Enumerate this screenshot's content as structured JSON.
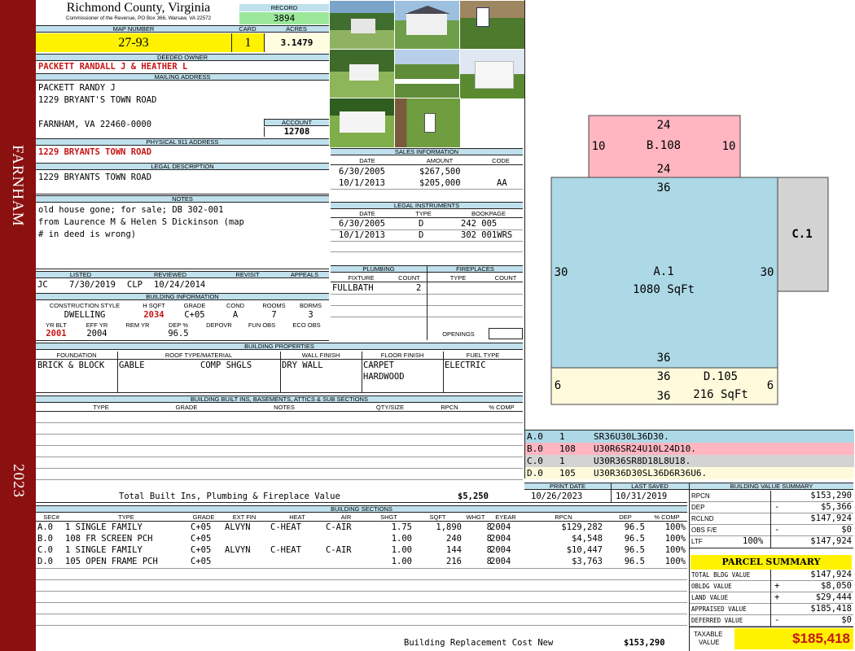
{
  "sidebar": {
    "city": "FARNHAM",
    "year": "2023"
  },
  "header": {
    "county": "Richmond County, Virginia",
    "commissioner": "Commissioner of the Revenue, PO Box 366, Warsaw, VA 22572",
    "record_label": "RECORD",
    "record": "3894",
    "map_number_label": "MAP NUMBER",
    "map_number": "27-93",
    "card_label": "CARD",
    "card": "1",
    "acres_label": "ACRES",
    "acres": "3.1479"
  },
  "owner": {
    "deeded_owner_label": "DEEDED OWNER",
    "deeded_owner": "PACKETT RANDALL J & HEATHER L",
    "mailing_label": "MAILING ADDRESS",
    "mailing_line1": "PACKETT RANDY J",
    "mailing_line2": "1229 BRYANT'S TOWN ROAD",
    "mailing_line3": "FARNHAM, VA 22460-0000",
    "account_label": "ACCOUNT",
    "account": "12708",
    "physical_label": "PHYSICAL 911 ADDRESS",
    "physical": "1229 BRYANTS TOWN ROAD",
    "legal_label": "LEGAL DESCRIPTION",
    "legal": "1229 BRYANTS TOWN ROAD",
    "notes_label": "NOTES",
    "notes_line1": "old house gone; for sale; DB 302-001",
    "notes_line2": "from Laurence M & Helen S Dickinson (map",
    "notes_line3": "# in deed is wrong)"
  },
  "review": {
    "listed_label": "LISTED",
    "reviewed_label": "REVIEWED",
    "revisit_label": "REVISIT",
    "appeals_label": "APPEALS",
    "listed_by": "JC",
    "listed_date": "7/30/2019",
    "reviewed_by": "CLP",
    "reviewed_date": "10/24/2014"
  },
  "building_info": {
    "title": "BUILDING INFORMATION",
    "headers": [
      "CONSTRUCTION STYLE",
      "H SQFT",
      "GRADE",
      "COND",
      "ROOMS",
      "BDRMS"
    ],
    "style": "DWELLING",
    "hsqft": "2034",
    "grade": "C+05",
    "cond": "A",
    "rooms": "7",
    "bdrms": "3",
    "headers2": [
      "YR BLT",
      "EFF YR",
      "REM YR",
      "DEP %",
      "DEPOVR",
      "FUN OBS",
      "ECO OBS"
    ],
    "yr_blt": "2001",
    "eff_yr": "2004",
    "dep": "96.5"
  },
  "sales": {
    "title": "SALES INFORMATION",
    "headers": [
      "DATE",
      "AMOUNT",
      "CODE"
    ],
    "rows": [
      {
        "date": "6/30/2005",
        "amount": "$267,500",
        "code": ""
      },
      {
        "date": "10/1/2013",
        "amount": "$205,000",
        "code": "AA"
      }
    ]
  },
  "legal_instruments": {
    "title": "LEGAL INSTRUMENTS",
    "headers": [
      "DATE",
      "TYPE",
      "BOOKPAGE"
    ],
    "rows": [
      {
        "date": "6/30/2005",
        "type": "D",
        "bookpage": "242 005"
      },
      {
        "date": "10/1/2013",
        "type": "D",
        "bookpage": "302 001WRS"
      }
    ]
  },
  "plumbing": {
    "title": "PLUMBING",
    "fixture_label": "FIXTURE",
    "count_label": "COUNT",
    "fixture": "FULLBATH",
    "count": "2"
  },
  "fireplaces": {
    "title": "FIREPLACES",
    "type_label": "TYPE",
    "count_label": "COUNT",
    "openings_label": "OPENINGS"
  },
  "building_properties": {
    "title": "BUILDING PROPERTIES",
    "headers": [
      "FOUNDATION",
      "ROOF TYPE/MATERIAL",
      "WALL FINISH",
      "FLOOR FINISH",
      "FUEL TYPE"
    ],
    "foundation": "BRICK & BLOCK",
    "roof_type": "GABLE",
    "roof_material": "COMP SHGLS",
    "wall": "DRY WALL",
    "floor1": "CARPET",
    "floor2": "HARDWOOD",
    "fuel": "ELECTRIC"
  },
  "built_ins": {
    "title": "BUILDING BUILT INS, BASEMENTS, ATTICS & SUB SECTIONS",
    "headers": [
      "TYPE",
      "GRADE",
      "NOTES",
      "QTY/SIZE",
      "RPCN",
      "% COMP"
    ],
    "total_label": "Total Built Ins, Plumbing & Fireplace Value",
    "total": "$5,250"
  },
  "sections": {
    "title": "BUILDING SECTIONS",
    "headers": [
      "SEC#",
      "TYPE",
      "GRADE",
      "EXT FIN",
      "HEAT",
      "AIR",
      "SHGT",
      "SQFT",
      "WHGT",
      "EYEAR",
      "RPCN",
      "DEP",
      "% COMP"
    ],
    "rows": [
      {
        "sec": "A.0",
        "type": "1 SINGLE FAMILY",
        "grade": "C+05",
        "ext": "ALVYN",
        "heat": "C-HEAT",
        "air": "C-AIR",
        "shgt": "1.75",
        "sqft": "1,890",
        "whgt": "8",
        "eyear": "2004",
        "rpcn": "$129,282",
        "dep": "96.5",
        "comp": "100%"
      },
      {
        "sec": "B.0",
        "type": "108 FR SCREEN PCH",
        "grade": "C+05",
        "ext": "",
        "heat": "",
        "air": "",
        "shgt": "1.00",
        "sqft": "240",
        "whgt": "8",
        "eyear": "2004",
        "rpcn": "$4,548",
        "dep": "96.5",
        "comp": "100%"
      },
      {
        "sec": "C.0",
        "type": "1 SINGLE FAMILY",
        "grade": "C+05",
        "ext": "ALVYN",
        "heat": "C-HEAT",
        "air": "C-AIR",
        "shgt": "1.00",
        "sqft": "144",
        "whgt": "8",
        "eyear": "2004",
        "rpcn": "$10,447",
        "dep": "96.5",
        "comp": "100%"
      },
      {
        "sec": "D.0",
        "type": "105 OPEN FRAME PCH",
        "grade": "C+05",
        "ext": "",
        "heat": "",
        "air": "",
        "shgt": "1.00",
        "sqft": "216",
        "whgt": "8",
        "eyear": "2004",
        "rpcn": "$3,763",
        "dep": "96.5",
        "comp": "100%"
      }
    ],
    "replacement_label": "Building Replacement Cost New",
    "replacement": "$153,290"
  },
  "sketch": {
    "b_top": "24",
    "b_left": "10",
    "b_label": "B.108",
    "b_right": "10",
    "b_bottom": "24",
    "a_top": "36",
    "a_left": "30",
    "a_label": "A.1",
    "a_right": "30",
    "a_sqft": "1080 SqFt",
    "a_bottom": "36",
    "c_label": "C.1",
    "d_top": "36",
    "d_left": "6",
    "d_label": "D.105",
    "d_right": "6",
    "d_sqft": "216 SqFt",
    "d_bottom": "36",
    "colors": {
      "a": "#add8e6",
      "b": "#ffb6c1",
      "c": "#d3d3d3",
      "d": "#fffadc"
    }
  },
  "sketch_key": [
    {
      "code": "A.0",
      "n": "1",
      "path": "SR36U30L36D30."
    },
    {
      "code": "B.0",
      "n": "108",
      "path": "U30R6SR24U10L24D10."
    },
    {
      "code": "C.0",
      "n": "1",
      "path": "U30R36SR8D18L8U18."
    },
    {
      "code": "D.0",
      "n": "105",
      "path": "U30R36D30SL36D6R36U6."
    }
  ],
  "dates": {
    "print_label": "PRINT DATE",
    "print_date": "10/26/2023",
    "saved_label": "LAST SAVED",
    "saved_date": "10/31/2019"
  },
  "value_summary": {
    "title": "BUILDING VALUE SUMMARY",
    "rpcn_label": "RPCN",
    "rpcn": "$153,290",
    "dep_label": "DEP",
    "dep_sign": "-",
    "dep": "$5,366",
    "rclnd_label": "RCLND",
    "rclnd": "$147,924",
    "obs_label": "OBS F/E",
    "obs_sign": "-",
    "obs": "$0",
    "ltr_label": "LTF",
    "ltr_pct": "100%",
    "ltr": "$147,924"
  },
  "parcel": {
    "title": "PARCEL SUMMARY",
    "total_bldg_label": "TOTAL BLDG VALUE",
    "total_bldg": "$147,924",
    "oblg_label": "OBLDG VALUE",
    "oblg_sign": "+",
    "oblg": "$8,050",
    "land_label": "LAND VALUE",
    "land_sign": "+",
    "land": "$29,444",
    "appraised_label": "APPRAISED VALUE",
    "appraised": "$185,418",
    "deferred_label": "DEFERRED VALUE",
    "deferred_sign": "-",
    "deferred": "$0",
    "taxable_label1": "TAXABLE",
    "taxable_label2": "VALUE",
    "taxable": "$185,418"
  }
}
